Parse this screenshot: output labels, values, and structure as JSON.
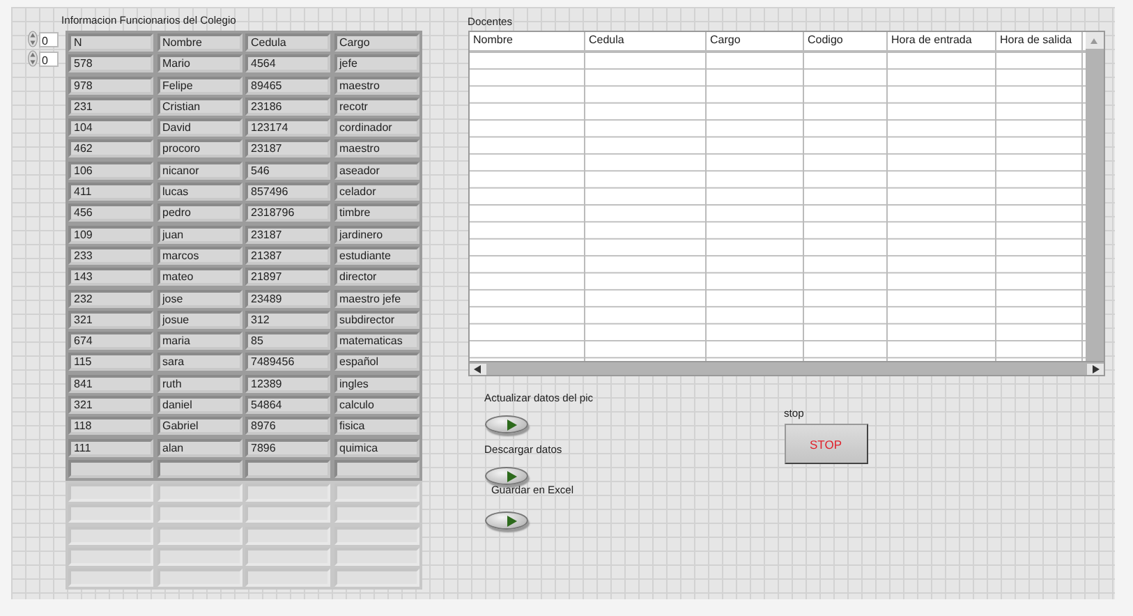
{
  "array": {
    "title": "Informacion Funcionarios del Colegio",
    "indices": [
      "0",
      "0"
    ],
    "rows": [
      [
        "N",
        "Nombre",
        "Cedula",
        "Cargo"
      ],
      [
        "578",
        "Mario",
        "4564",
        "jefe"
      ],
      [
        "978",
        "Felipe",
        "89465",
        "maestro"
      ],
      [
        "231",
        "Cristian",
        "23186",
        "recotr"
      ],
      [
        "104",
        "David",
        "123174",
        "cordinador"
      ],
      [
        "462",
        "procoro",
        "23187",
        "maestro"
      ],
      [
        "106",
        "nicanor",
        "546",
        "aseador"
      ],
      [
        "411",
        "lucas",
        "857496",
        "celador"
      ],
      [
        "456",
        "pedro",
        "2318796",
        "timbre"
      ],
      [
        "109",
        "juan",
        "23187",
        "jardinero"
      ],
      [
        "233",
        "marcos",
        "21387",
        "estudiante"
      ],
      [
        "143",
        "mateo",
        "21897",
        "director"
      ],
      [
        "232",
        "jose",
        "23489",
        "maestro jefe"
      ],
      [
        "321",
        "josue",
        "312",
        "subdirector"
      ],
      [
        "674",
        "maria",
        "85",
        "matematicas"
      ],
      [
        "115",
        "sara",
        "7489456",
        "español"
      ],
      [
        "841",
        "ruth",
        "12389",
        "ingles"
      ],
      [
        "321",
        "daniel",
        "54864",
        "calculo"
      ],
      [
        "118",
        "Gabriel",
        "8976",
        "fisica"
      ],
      [
        "111",
        "alan",
        "7896",
        "quimica"
      ]
    ]
  },
  "table": {
    "title": "Docentes",
    "columns": [
      "Nombre",
      "Cedula",
      "Cargo",
      "Codigo",
      "Hora de entrada",
      "Hora de salida"
    ]
  },
  "switches": [
    {
      "label": "Actualizar datos del pic",
      "on": true
    },
    {
      "label": "Descargar datos",
      "on": true
    },
    {
      "label": "Guardar  en Excel",
      "on": true
    }
  ],
  "stop": {
    "label": "stop",
    "button": "STOP"
  }
}
